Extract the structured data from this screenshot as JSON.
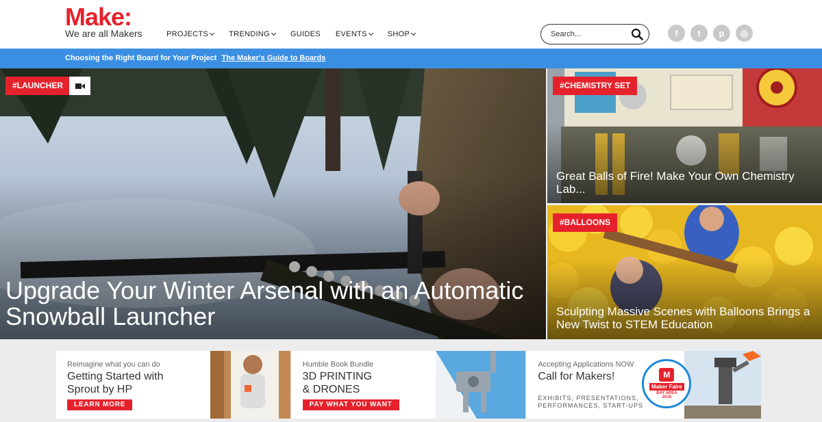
{
  "logo": {
    "main": "Make:",
    "tagline": "We are all Makers"
  },
  "nav": {
    "items": [
      {
        "label": "PROJECTS",
        "has_dropdown": true
      },
      {
        "label": "TRENDING",
        "has_dropdown": true
      },
      {
        "label": "GUIDES",
        "has_dropdown": false
      },
      {
        "label": "EVENTS",
        "has_dropdown": true
      },
      {
        "label": "SHOP",
        "has_dropdown": true
      }
    ]
  },
  "search": {
    "placeholder": "Search...",
    "icon": "search-icon"
  },
  "socials": [
    {
      "name": "facebook",
      "glyph": "f"
    },
    {
      "name": "twitter",
      "glyph": "t"
    },
    {
      "name": "pinterest",
      "glyph": "p"
    },
    {
      "name": "instagram",
      "glyph": "◎"
    }
  ],
  "promo": {
    "text": "Choosing the Right Board for Your Project",
    "link": "The Maker's Guide to Boards"
  },
  "hero": {
    "tag": "#LAUNCHER",
    "title": "Upgrade Your Winter Arsenal with an Automatic Snowball Launcher",
    "media_icon": "video-camera-icon"
  },
  "side_stories": [
    {
      "tag": "#CHEMISTRY SET",
      "title": "Great Balls of Fire! Make Your Own Chemistry Lab..."
    },
    {
      "tag": "#BALLOONS",
      "title": "Sculpting Massive Scenes with Balloons Brings a New Twist to STEM Education"
    }
  ],
  "ads": [
    {
      "eyebrow": "Reimagine what you can do",
      "title": "Getting Started with Sprout by HP",
      "button": "LEARN MORE"
    },
    {
      "eyebrow": "Humble Book Bundle",
      "title": "3D PRINTING & DRONES",
      "button": "PAY WHAT YOU WANT"
    },
    {
      "eyebrow": "Accepting Applications NOW",
      "title": "Call for Makers!",
      "details": "EXHIBITS, PRESENTATIONS, PERFORMANCES, START-UPS",
      "badge_text": "Maker Faire",
      "badge_sub": "BAY AREA",
      "badge_year": "2016"
    }
  ],
  "colors": {
    "brand_red": "#e5222c",
    "promo_blue": "#3b8fe3"
  }
}
